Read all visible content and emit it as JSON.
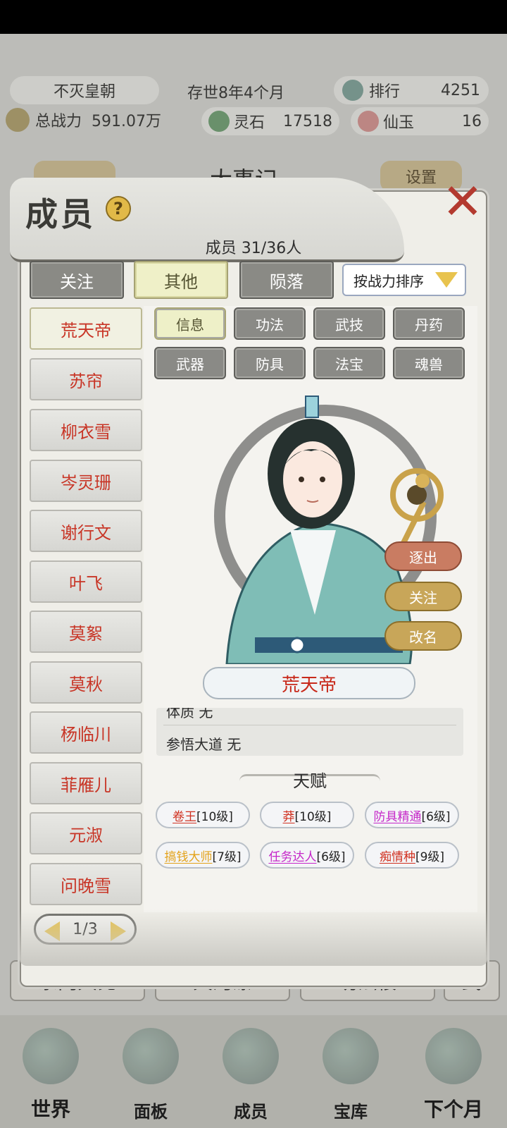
{
  "hud": {
    "dynasty": "不灭皇朝",
    "age": "存世8年4个月",
    "rank_label": "排行",
    "rank_value": "4251",
    "power_label": "总战力",
    "power_value": "591.07万",
    "spirit_stone_label": "灵石",
    "spirit_stone_value": "17518",
    "jade_label": "仙玉",
    "jade_value": "16",
    "center_title": "大事记",
    "settings_label": "设置"
  },
  "background_buttons": [
    "宗门大比",
    "天河瀑",
    "功法楼",
    "武"
  ],
  "nav": {
    "items": [
      {
        "label": "世界",
        "icon": "globe-icon"
      },
      {
        "label": "面板",
        "icon": "scroll-icon"
      },
      {
        "label": "成员",
        "icon": "person-icon"
      },
      {
        "label": "宝库",
        "icon": "yinyang-icon"
      },
      {
        "label": "下个月",
        "icon": "sun-icon"
      }
    ]
  },
  "dialog": {
    "title": "成员",
    "help_glyph": "?",
    "close_glyph": "✕",
    "member_count": "成员  31/36人",
    "filters": [
      {
        "label": "关注",
        "active": false
      },
      {
        "label": "其他",
        "active": true
      },
      {
        "label": "陨落",
        "active": false
      }
    ],
    "sort_label": "按战力排序",
    "members": [
      "荒天帝",
      "苏帘",
      "柳衣雪",
      "岑灵珊",
      "谢行文",
      "叶飞",
      "莫絮",
      "莫秋",
      "杨临川",
      "菲雁儿",
      "元淑",
      "问晚雪"
    ],
    "active_member_index": 0,
    "page": "1/3",
    "tabs": [
      {
        "label": "信息",
        "active": true
      },
      {
        "label": "功法",
        "active": false
      },
      {
        "label": "武技",
        "active": false
      },
      {
        "label": "丹药",
        "active": false
      },
      {
        "label": "武器",
        "active": false
      },
      {
        "label": "防具",
        "active": false
      },
      {
        "label": "法宝",
        "active": false
      },
      {
        "label": "魂兽",
        "active": false
      }
    ],
    "actions": {
      "expel": "逐出",
      "follow": "关注",
      "rename": "改名"
    },
    "character_name": "荒天帝",
    "info_rows": [
      {
        "label": "体质",
        "value": "无"
      },
      {
        "label": "参悟大道",
        "value": "无"
      }
    ],
    "talent_header": "天赋",
    "talents": [
      {
        "name": "卷王",
        "level": "[10级]",
        "color": "#d0301f"
      },
      {
        "name": "莽",
        "level": "[10级]",
        "color": "#d0301f"
      },
      {
        "name": "防具精通",
        "level": "[6级]",
        "color": "#c526c8"
      },
      {
        "name": "搞钱大师",
        "level": "[7级]",
        "color": "#e3a21a"
      },
      {
        "name": "任务达人",
        "level": "[6级]",
        "color": "#c526c8"
      },
      {
        "name": "痴情种",
        "level": "[9级]",
        "color": "#d0301f"
      }
    ]
  }
}
